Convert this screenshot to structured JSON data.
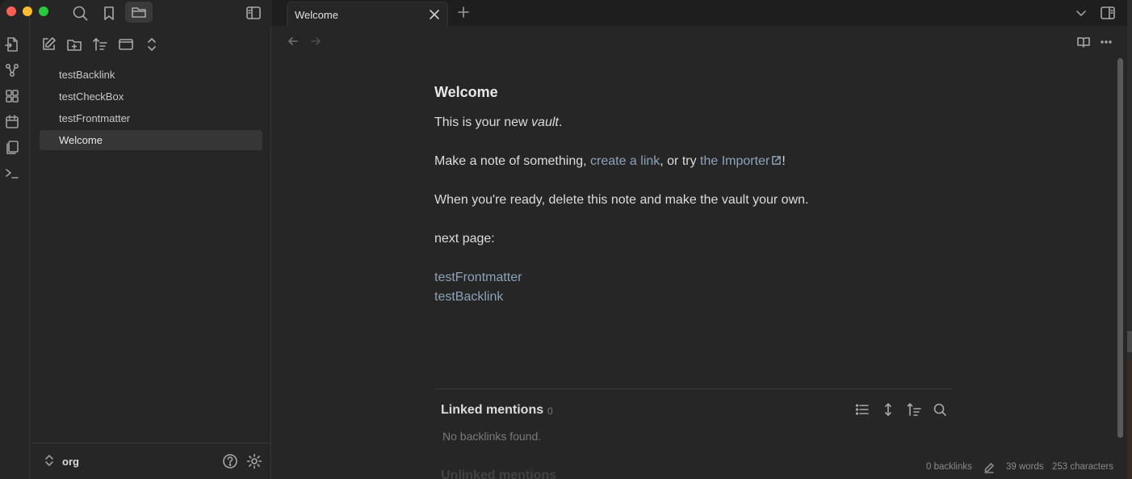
{
  "window": {
    "traffic_lights": {
      "close": "#ff5f57",
      "minimize": "#febc2e",
      "zoom": "#28c840"
    }
  },
  "colors": {
    "accent_link": "#8ea3b8",
    "background": "#262626"
  },
  "sidebar": {
    "files": [
      {
        "label": "testBacklink"
      },
      {
        "label": "testCheckBox"
      },
      {
        "label": "testFrontmatter"
      },
      {
        "label": "Welcome",
        "active": true
      }
    ],
    "vault_name": "org"
  },
  "tabs": [
    {
      "label": "Welcome"
    }
  ],
  "note": {
    "title": "Welcome",
    "line1_before": "This is your new ",
    "line1_em": "vault",
    "line1_after": ".",
    "line2_before": "Make a note of something, ",
    "line2_link1": "create a link",
    "line2_mid": ", or try ",
    "line2_link2": "the Importer",
    "line2_after": "!",
    "line3": "When you're ready, delete this note and make the vault your own.",
    "line4": "next page:",
    "link_a": "testFrontmatter",
    "link_b": "testBacklink"
  },
  "backlinks": {
    "title": "Linked mentions",
    "count": "0",
    "empty_text": "No backlinks found.",
    "unlinked_title": "Unlinked mentions"
  },
  "status": {
    "backlinks": "0 backlinks",
    "words": "39 words",
    "characters": "253 characters"
  }
}
